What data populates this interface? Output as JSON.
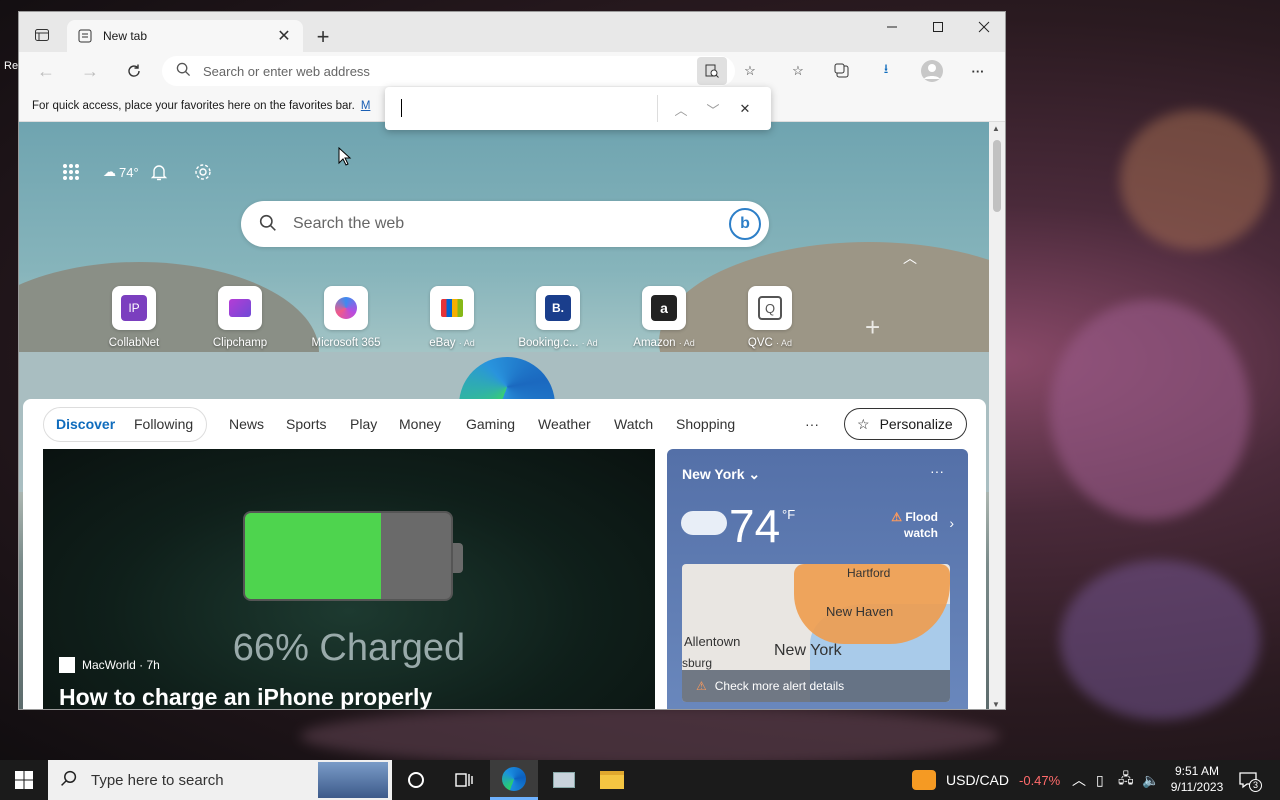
{
  "desktop": {
    "edge_text": "Re"
  },
  "browser": {
    "tab": {
      "title": "New tab"
    },
    "address_placeholder": "Search or enter web address",
    "favbar": {
      "text": "For quick access, place your favorites here on the favorites bar.",
      "link": "M"
    },
    "find_bar": {
      "value": ""
    }
  },
  "ntp": {
    "weather_temp": "74°",
    "search_placeholder": "Search the web",
    "tiles": [
      {
        "label": "CollabNet",
        "ad": "",
        "icon": "IP"
      },
      {
        "label": "Clipchamp",
        "ad": "",
        "icon": "clipchamp-icon"
      },
      {
        "label": "Microsoft 365",
        "ad": "",
        "icon": "m365-icon"
      },
      {
        "label": "eBay",
        "ad": "· Ad",
        "icon": "ebay-icon"
      },
      {
        "label": "Booking.c...",
        "ad": "· Ad",
        "icon": "B."
      },
      {
        "label": "Amazon",
        "ad": "· Ad",
        "icon": "a"
      },
      {
        "label": "QVC",
        "ad": "· Ad",
        "icon": "Q"
      }
    ]
  },
  "feed": {
    "tabs": [
      "Discover",
      "Following",
      "News",
      "Sports",
      "Play",
      "Money",
      "Gaming",
      "Weather",
      "Watch",
      "Shopping"
    ],
    "more": "···",
    "personalize": "Personalize",
    "hero": {
      "image_text": "66% Charged",
      "battery_level": 0.66,
      "source": "MacWorld · 7h",
      "headline": "How to charge an iPhone properly"
    },
    "weather": {
      "city": "New York",
      "temp": "74",
      "unit": "°F",
      "alert_line1": "Flood",
      "alert_line2": "watch",
      "map_labels": [
        "Hartford",
        "New Haven",
        "Allentown",
        "sburg",
        "New York"
      ],
      "map_alert": "Check more alert details"
    }
  },
  "taskbar": {
    "search_placeholder": "Type here to search",
    "ticker_name": "USD/CAD",
    "ticker_change": "-0.47%",
    "time": "9:51 AM",
    "date": "9/11/2023",
    "notif_count": "3",
    "ticker_color": "#ff6b6b"
  }
}
